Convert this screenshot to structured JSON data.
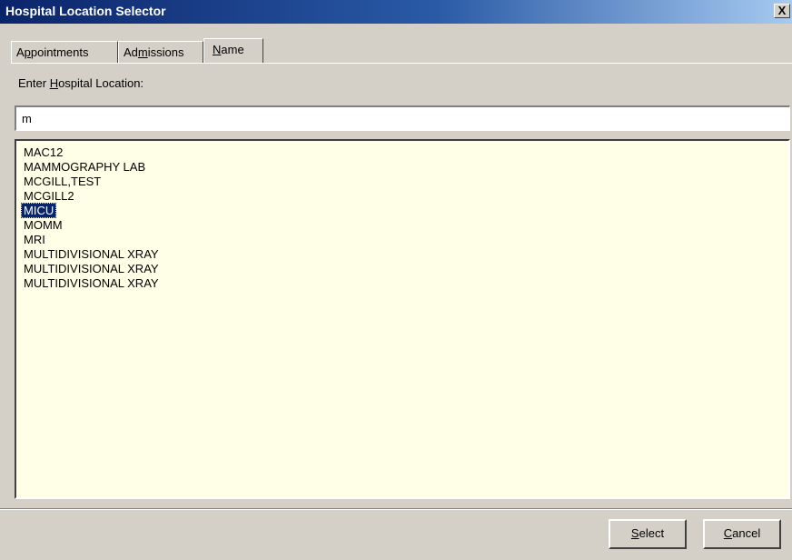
{
  "window": {
    "title": "Hospital Location Selector",
    "close_glyph": "X"
  },
  "tabs": [
    {
      "label": "Appointments",
      "active": false
    },
    {
      "label": "Admissions",
      "active": false
    },
    {
      "label": "Name",
      "active": true
    }
  ],
  "search": {
    "prompt": "Enter Hospital Location:",
    "value": "m"
  },
  "list": {
    "items": [
      "MAC12",
      "MAMMOGRAPHY LAB",
      "MCGILL,TEST",
      "MCGILL2",
      "MICU",
      "MOMM",
      "MRI",
      "MULTIDIVISIONAL XRAY",
      "MULTIDIVISIONAL XRAY",
      "MULTIDIVISIONAL XRAY"
    ],
    "selected_index": 4
  },
  "buttons": {
    "select_label": "Select",
    "cancel_label": "Cancel"
  },
  "colors": {
    "titlebar": "#0a246a",
    "list_background": "#ffffe8",
    "selection": "#0a246a",
    "face": "#d4d0c8"
  }
}
